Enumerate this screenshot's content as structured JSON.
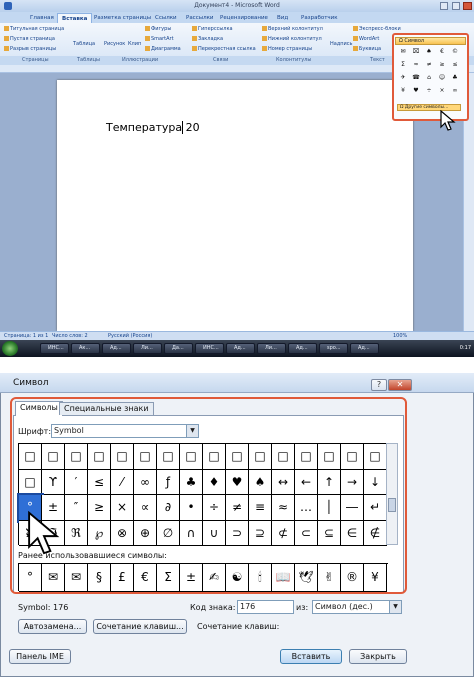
{
  "word": {
    "title": "Документ4 - Microsoft Word",
    "tabs": [
      "Главная",
      "Вставка",
      "Разметка страницы",
      "Ссылки",
      "Рассылки",
      "Рецензирование",
      "Вид",
      "Разработчик"
    ],
    "active_tab": "Вставка",
    "ribbon_items": {
      "cover_page": "Титульная страница",
      "blank_page": "Пустая страница",
      "page_break": "Разрыв страницы",
      "table": "Таблица",
      "picture": "Рисунок",
      "clip": "Клип",
      "shapes": "Фигуры",
      "smartart": "SmartArt",
      "diagram": "Диаграмма",
      "hyperlink": "Гиперссылка",
      "bookmark": "Закладка",
      "crossref": "Перекрестная ссылка",
      "header": "Верхний колонтитул",
      "footer": "Нижний колонтитул",
      "page_number": "Номер страницы",
      "textbox": "Надпись",
      "quickparts": "Экспресс-блоки",
      "wordart": "WordArt",
      "dropcap": "Буквица",
      "symbol": "Символ"
    },
    "groups": [
      "Страницы",
      "Таблицы",
      "Иллюстрации",
      "Связи",
      "Колонтитулы",
      "Текст"
    ],
    "document_text": "Температура 20",
    "symbol_dropdown": {
      "header": "Ω Символ",
      "symbols": [
        "✉",
        "⌧",
        "♠",
        "€",
        "©",
        "Σ",
        "≈",
        "≠",
        "≥",
        "≤",
        "✈",
        "☎",
        "⌂",
        "☺",
        "♣",
        "¥",
        "♥",
        "÷",
        "×",
        "∞"
      ],
      "more_label": "Ω Другие символы..."
    },
    "status": {
      "page": "Страница: 1 из 1",
      "words": "Число слов: 2",
      "lang": "Русский (Россия)",
      "zoom": "100%"
    },
    "taskbar_items": [
      "ИНС...",
      "Ак...",
      "Ад...",
      "Ли...",
      "Да...",
      "ИНС...",
      "Ад...",
      "Ли...",
      "Ад...",
      "spo...",
      "Ад..."
    ],
    "clock": "0:17"
  },
  "dialog": {
    "title": "Символ",
    "help": "?",
    "close": "✕",
    "tabs": [
      "Символы",
      "Специальные знаки"
    ],
    "font_label": "Шрифт:",
    "font_value": "Symbol",
    "grid_rows": [
      [
        "□",
        "□",
        "□",
        "□",
        "□",
        "□",
        "□",
        "□",
        "□",
        "□",
        "□",
        "□",
        "□",
        "□",
        "□",
        "□"
      ],
      [
        "□",
        "ϒ",
        "′",
        "≤",
        "⁄",
        "∞",
        "ƒ",
        "♣",
        "♦",
        "♥",
        "♠",
        "↔",
        "←",
        "↑",
        "→",
        "↓"
      ],
      [
        "°",
        "±",
        "″",
        "≥",
        "×",
        "∝",
        "∂",
        "•",
        "÷",
        "≠",
        "≡",
        "≈",
        "…",
        "│",
        "―",
        "↵"
      ],
      [
        "ℵ",
        "ℑ",
        "ℜ",
        "℘",
        "⊗",
        "⊕",
        "∅",
        "∩",
        "∪",
        "⊃",
        "⊇",
        "⊄",
        "⊂",
        "⊆",
        "∈",
        "∉"
      ]
    ],
    "selected": "°",
    "recent_label": "Ранее использовавшиеся символы:",
    "recent": [
      "°",
      "✉",
      "✉",
      "§",
      "£",
      "€",
      "Σ",
      "±",
      "✍",
      "☯",
      "🕯",
      "📖",
      "🕊",
      "✌",
      "®",
      "¥"
    ],
    "code_name": "Symbol: 176",
    "code_label": "Код знака:",
    "code_value": "176",
    "from_label": "из:",
    "from_value": "Символ (дес.)",
    "autocorrect": "Автозамена...",
    "shortcut_btn": "Сочетание клавиш...",
    "shortcut_label": "Сочетание клавиш:",
    "ime": "Панель IME",
    "insert": "Вставить",
    "close_btn": "Закрыть"
  }
}
